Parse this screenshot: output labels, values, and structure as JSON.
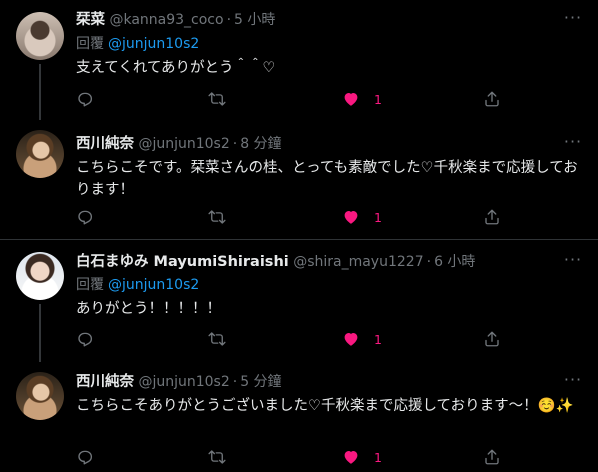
{
  "tweets": [
    {
      "name": "栞菜",
      "handle": "@kanna93_coco",
      "time": "5 小時",
      "reply_label": "回覆",
      "reply_to": "@junjun10s2",
      "text": "支えてくれてありがとう＾＾♡",
      "likes": "1"
    },
    {
      "name": "西川純奈",
      "handle": "@junjun10s2",
      "time": "8 分鐘",
      "text": "こちらこそです。栞菜さんの桂、とっても素敵でした♡千秋楽まで応援しております！",
      "likes": "1"
    },
    {
      "name": "白石まゆみ MayumiShiraishi",
      "handle": "@shira_mayu1227",
      "time": "6 小時",
      "reply_label": "回覆",
      "reply_to": "@junjun10s2",
      "text": "ありがとう！！！！！",
      "likes": "1"
    },
    {
      "name": "西川純奈",
      "handle": "@junjun10s2",
      "time": "5 分鐘",
      "text": "こちらこそありがとうございました♡千秋楽まで応援しております〜！☺️✨",
      "likes": "1"
    }
  ],
  "colors": {
    "background": "#000000",
    "text": "#e7e9ea",
    "muted": "#71767b",
    "link": "#1d9bf0",
    "like": "#f91880",
    "divider": "#2f3336"
  },
  "icons": [
    "more-icon",
    "reply-icon",
    "retweet-icon",
    "heart-icon",
    "share-icon"
  ]
}
